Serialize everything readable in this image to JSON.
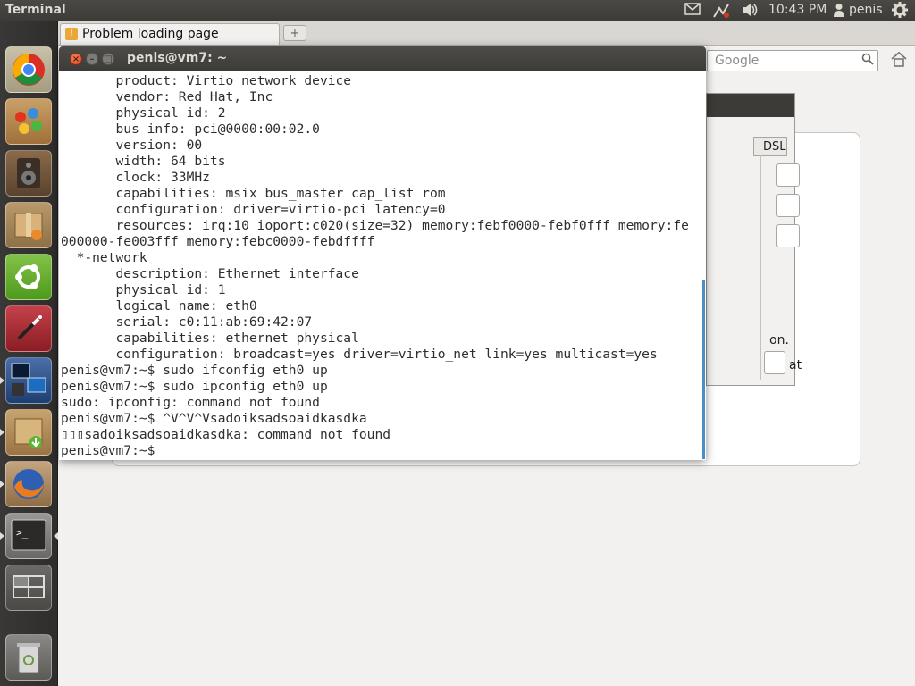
{
  "top_panel": {
    "app_title": "Terminal",
    "clock": "10:43 PM",
    "user": "penis"
  },
  "launcher": {
    "items": [
      "chromium-icon",
      "paint-icon",
      "speaker-icon",
      "package-install-icon",
      "ubuntu-one-icon",
      "magic-wand-icon",
      "remote-desktop-icon",
      "software-center-icon",
      "firefox-icon",
      "terminal-icon",
      "workspace-switcher-icon",
      "trash-icon"
    ]
  },
  "browser": {
    "tab_title": "Problem loading page",
    "search_placeholder": "Google",
    "bg_dialog_tab": "DSL",
    "bg_dialog_text_1": "on.",
    "bg_dialog_text_2": "at"
  },
  "terminal": {
    "title": "penis@vm7: ~",
    "lines": [
      "       product: Virtio network device",
      "       vendor: Red Hat, Inc",
      "       physical id: 2",
      "       bus info: pci@0000:00:02.0",
      "       version: 00",
      "       width: 64 bits",
      "       clock: 33MHz",
      "       capabilities: msix bus_master cap_list rom",
      "       configuration: driver=virtio-pci latency=0",
      "       resources: irq:10 ioport:c020(size=32) memory:febf0000-febf0fff memory:fe",
      "000000-fe003fff memory:febc0000-febdffff",
      "  *-network",
      "       description: Ethernet interface",
      "       physical id: 1",
      "       logical name: eth0",
      "       serial: c0:11:ab:69:42:07",
      "       capabilities: ethernet physical",
      "       configuration: broadcast=yes driver=virtio_net link=yes multicast=yes",
      "penis@vm7:~$ sudo ifconfig eth0 up",
      "penis@vm7:~$ sudo ipconfig eth0 up",
      "sudo: ipconfig: command not found",
      "penis@vm7:~$ ^V^V^Vsadoiksadsoaidkasdka",
      "▯▯▯sadoiksadsoaidkasdka: command not found",
      "penis@vm7:~$ "
    ]
  }
}
